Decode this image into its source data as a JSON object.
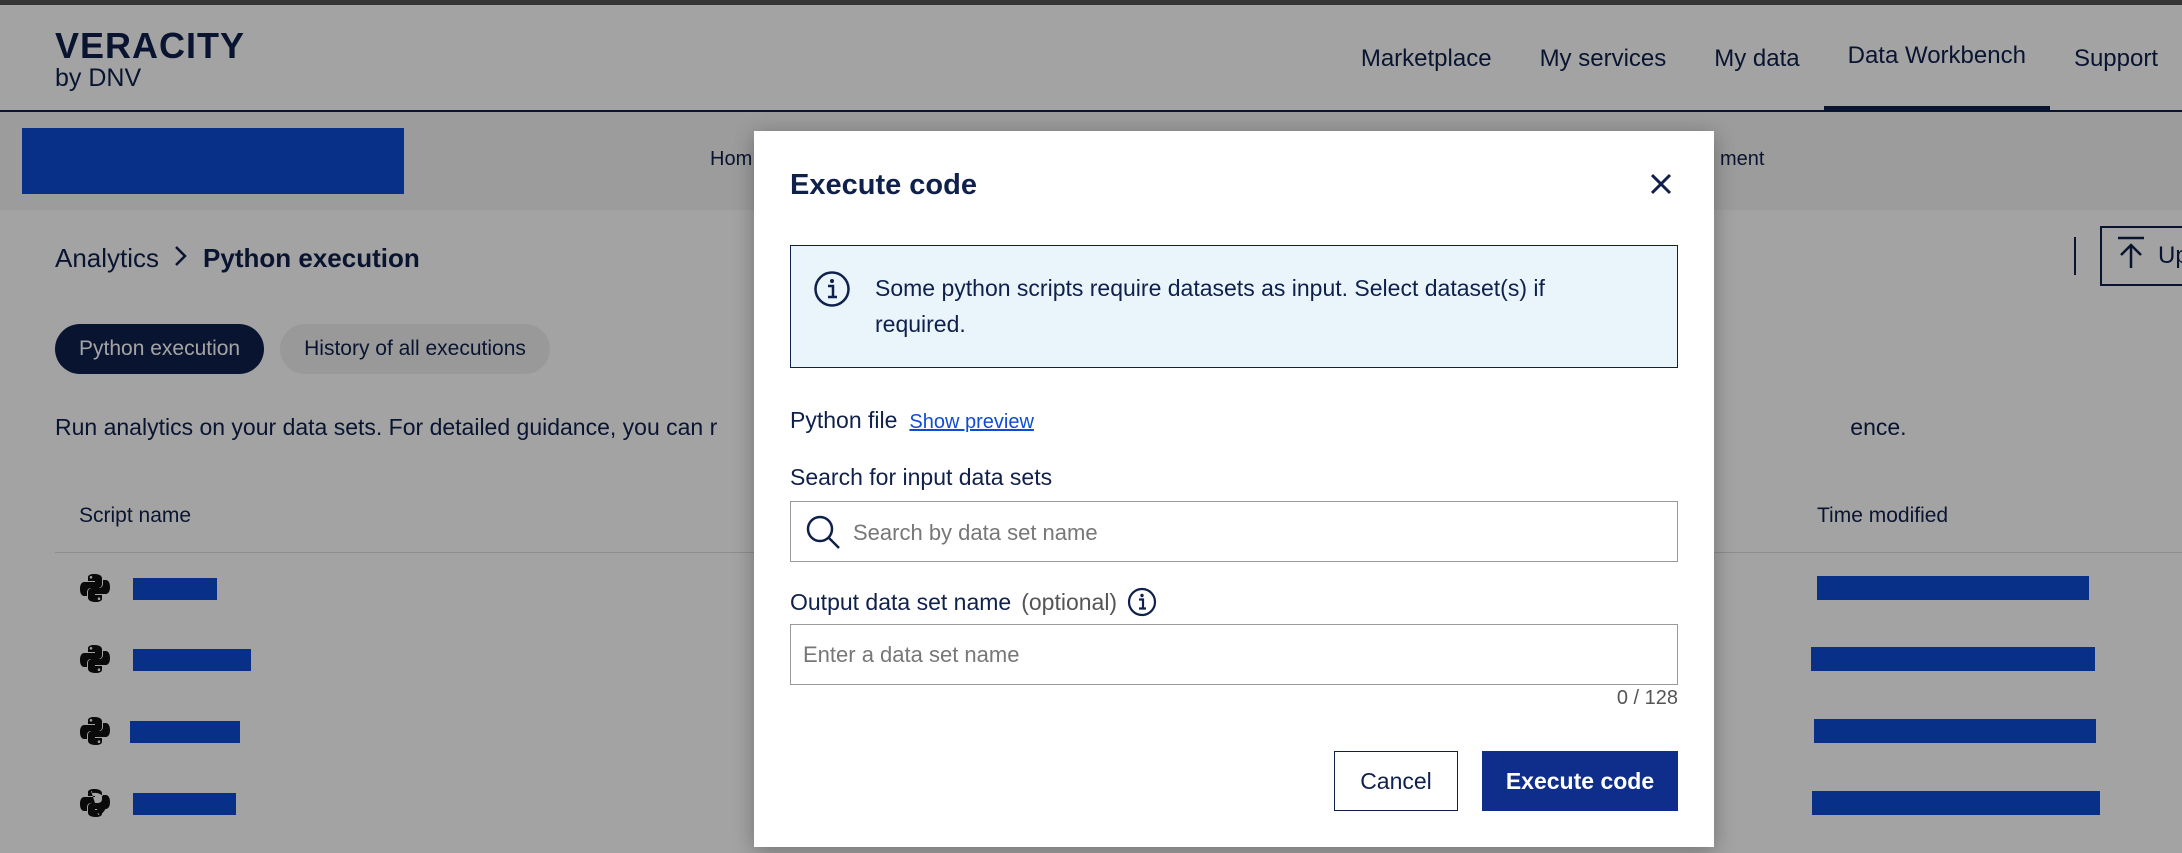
{
  "header": {
    "logo_main": "VERACITY",
    "logo_sub": "by DNV",
    "nav": [
      "Marketplace",
      "My services",
      "My data",
      "Data Workbench",
      "Support"
    ],
    "active_nav": "Data Workbench"
  },
  "subnav": {
    "left_fragment": "Hom",
    "right_fragment": "ment"
  },
  "breadcrumb": {
    "root": "Analytics",
    "current": "Python execution"
  },
  "toolbar": {
    "upload_fragment": "Up"
  },
  "tabs": [
    {
      "label": "Python execution",
      "active": true
    },
    {
      "label": "History of all executions",
      "active": false
    }
  ],
  "description": {
    "start": "Run analytics on your data sets. For detailed guidance, you can r",
    "end": "ence."
  },
  "table": {
    "columns": [
      "Script name",
      "Time modified"
    ]
  },
  "modal": {
    "title": "Execute code",
    "info_text": "Some python scripts require datasets as input. Select dataset(s) if required.",
    "python_file_label": "Python file",
    "show_preview_label": "Show preview",
    "search_label": "Search for input data sets",
    "search_placeholder": "Search by data set name",
    "output_label": "Output data set name",
    "output_optional": "(optional)",
    "output_placeholder": "Enter a data set name",
    "counter": "0 / 128",
    "cancel_label": "Cancel",
    "execute_label": "Execute code"
  },
  "colors": {
    "navy": "#0f204b",
    "accent_blue": "#0f4cd6",
    "info_bg": "#e9f4fb",
    "primary_button": "#0f2d8a"
  }
}
